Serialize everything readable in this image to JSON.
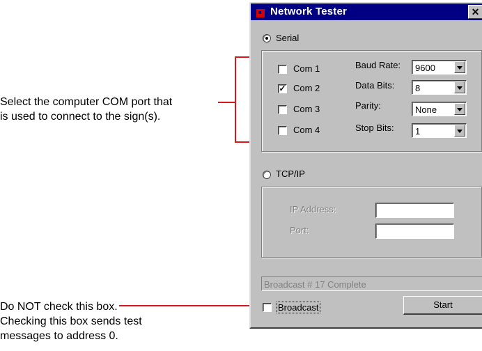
{
  "callouts": {
    "com_port": [
      "Select the computer COM port that",
      "is used to connect to the sign(s)."
    ],
    "broadcast": [
      "Do NOT check this box.",
      "Checking this box sends test",
      "messages to address 0."
    ]
  },
  "window": {
    "title": "Network Tester",
    "close_glyph": "✕",
    "serial_label": "Serial",
    "serial_selected": true,
    "ports": [
      {
        "label": "Com 1",
        "checked": false
      },
      {
        "label": "Com 2",
        "checked": true
      },
      {
        "label": "Com 3",
        "checked": false
      },
      {
        "label": "Com 4",
        "checked": false
      }
    ],
    "settings": [
      {
        "label": "Baud Rate:",
        "value": "9600"
      },
      {
        "label": "Data Bits:",
        "value": "8"
      },
      {
        "label": "Parity:",
        "value": "None"
      },
      {
        "label": "Stop Bits:",
        "value": "1"
      }
    ],
    "tcpip_label": "TCP/IP",
    "tcpip_selected": false,
    "ip_address_label": "IP Address:",
    "ip_address_value": "",
    "port_label": "Port:",
    "port_value": "",
    "status_text": "Broadcast #  17 Complete",
    "broadcast_label": "Broadcast",
    "broadcast_checked": false,
    "start_label": "Start"
  },
  "colors": {
    "callout_line": "#d81818",
    "titlebar": "#000082",
    "face": "#c0c0c0"
  }
}
